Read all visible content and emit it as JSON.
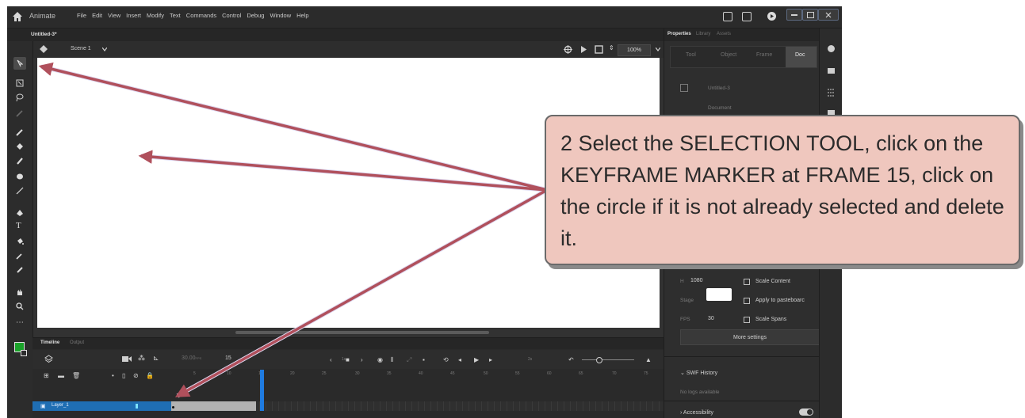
{
  "app": {
    "name": "Animate",
    "menu": [
      "File",
      "Edit",
      "View",
      "Insert",
      "Modify",
      "Text",
      "Commands",
      "Control",
      "Debug",
      "Window",
      "Help"
    ]
  },
  "document": {
    "tab": "Untitled-3*",
    "scene": "Scene 1",
    "zoom": "100%"
  },
  "timeline": {
    "tabs": [
      "Timeline",
      "Output"
    ],
    "fps": "30.00",
    "fps_unit": "FPS",
    "frame": "15",
    "seconds": [
      "1s",
      "2s"
    ],
    "ruler": [
      "5",
      "10",
      "15",
      "20",
      "25",
      "30",
      "35",
      "40",
      "45",
      "50",
      "55",
      "60",
      "65",
      "70",
      "75"
    ],
    "layer_name": "Layer_1"
  },
  "properties": {
    "tabs": [
      "Properties",
      "Library",
      "Assets"
    ],
    "segments": [
      "Tool",
      "Object",
      "Frame",
      "Doc"
    ],
    "doc_name": "Untitled-3",
    "doc_type": "Document",
    "height_label": "H",
    "height_value": "1080",
    "stage_label": "Stage",
    "fps_label": "FPS",
    "fps_value": "30",
    "scale_content": "Scale Content",
    "apply_pasteboard": "Apply to pasteboarc",
    "scale_spans": "Scale Spans",
    "more_settings": "More settings",
    "swf_history": "SWF History",
    "no_logs": "No logs available",
    "accessibility": "Accessibility",
    "stage_color": "#ffffff"
  },
  "callout": {
    "text": "2  Select the SELECTION TOOL, click on the KEYFRAME MARKER at FRAME 15, click on the circle if it is not already selected and delete it."
  },
  "colors": {
    "callout_bg": "#efc7be",
    "arrow": "#b0505c",
    "fill_color": "#1aa32a",
    "layer_highlight": "#1f6eb3",
    "playhead": "#1f7be0"
  }
}
